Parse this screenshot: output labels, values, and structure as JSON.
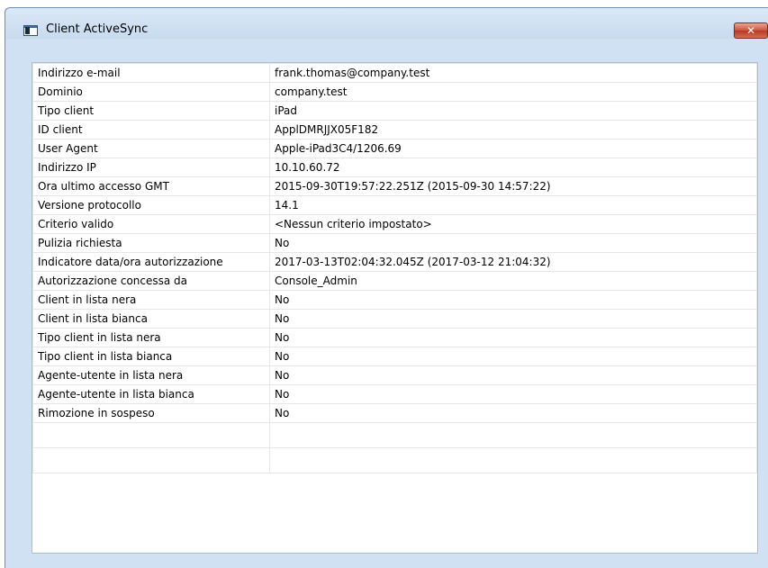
{
  "window": {
    "title": "Client ActiveSync",
    "close_glyph": "✕"
  },
  "properties": [
    {
      "label": "Indirizzo e-mail",
      "value": "frank.thomas@company.test"
    },
    {
      "label": "Dominio",
      "value": "company.test"
    },
    {
      "label": "Tipo client",
      "value": "iPad"
    },
    {
      "label": "ID client",
      "value": "ApplDMRJJX05F182"
    },
    {
      "label": "User Agent",
      "value": "Apple-iPad3C4/1206.69"
    },
    {
      "label": "Indirizzo IP",
      "value": "10.10.60.72"
    },
    {
      "label": "Ora ultimo accesso GMT",
      "value": "2015-09-30T19:57:22.251Z (2015-09-30 14:57:22)"
    },
    {
      "label": "Versione protocollo",
      "value": "14.1"
    },
    {
      "label": "Criterio valido",
      "value": "<Nessun criterio impostato>"
    },
    {
      "label": "Pulizia richiesta",
      "value": "No"
    },
    {
      "label": "Indicatore data/ora autorizzazione",
      "value": "2017-03-13T02:04:32.045Z (2017-03-12 21:04:32)"
    },
    {
      "label": "Autorizzazione concessa da",
      "value": "Console_Admin"
    },
    {
      "label": "Client in lista nera",
      "value": "No"
    },
    {
      "label": "Client in lista bianca",
      "value": "No"
    },
    {
      "label": "Tipo client in lista nera",
      "value": "No"
    },
    {
      "label": "Tipo client in lista bianca",
      "value": "No"
    },
    {
      "label": "Agente-utente in lista nera",
      "value": "No"
    },
    {
      "label": "Agente-utente in lista bianca",
      "value": "No"
    },
    {
      "label": "Rimozione in sospeso",
      "value": "No"
    }
  ]
}
